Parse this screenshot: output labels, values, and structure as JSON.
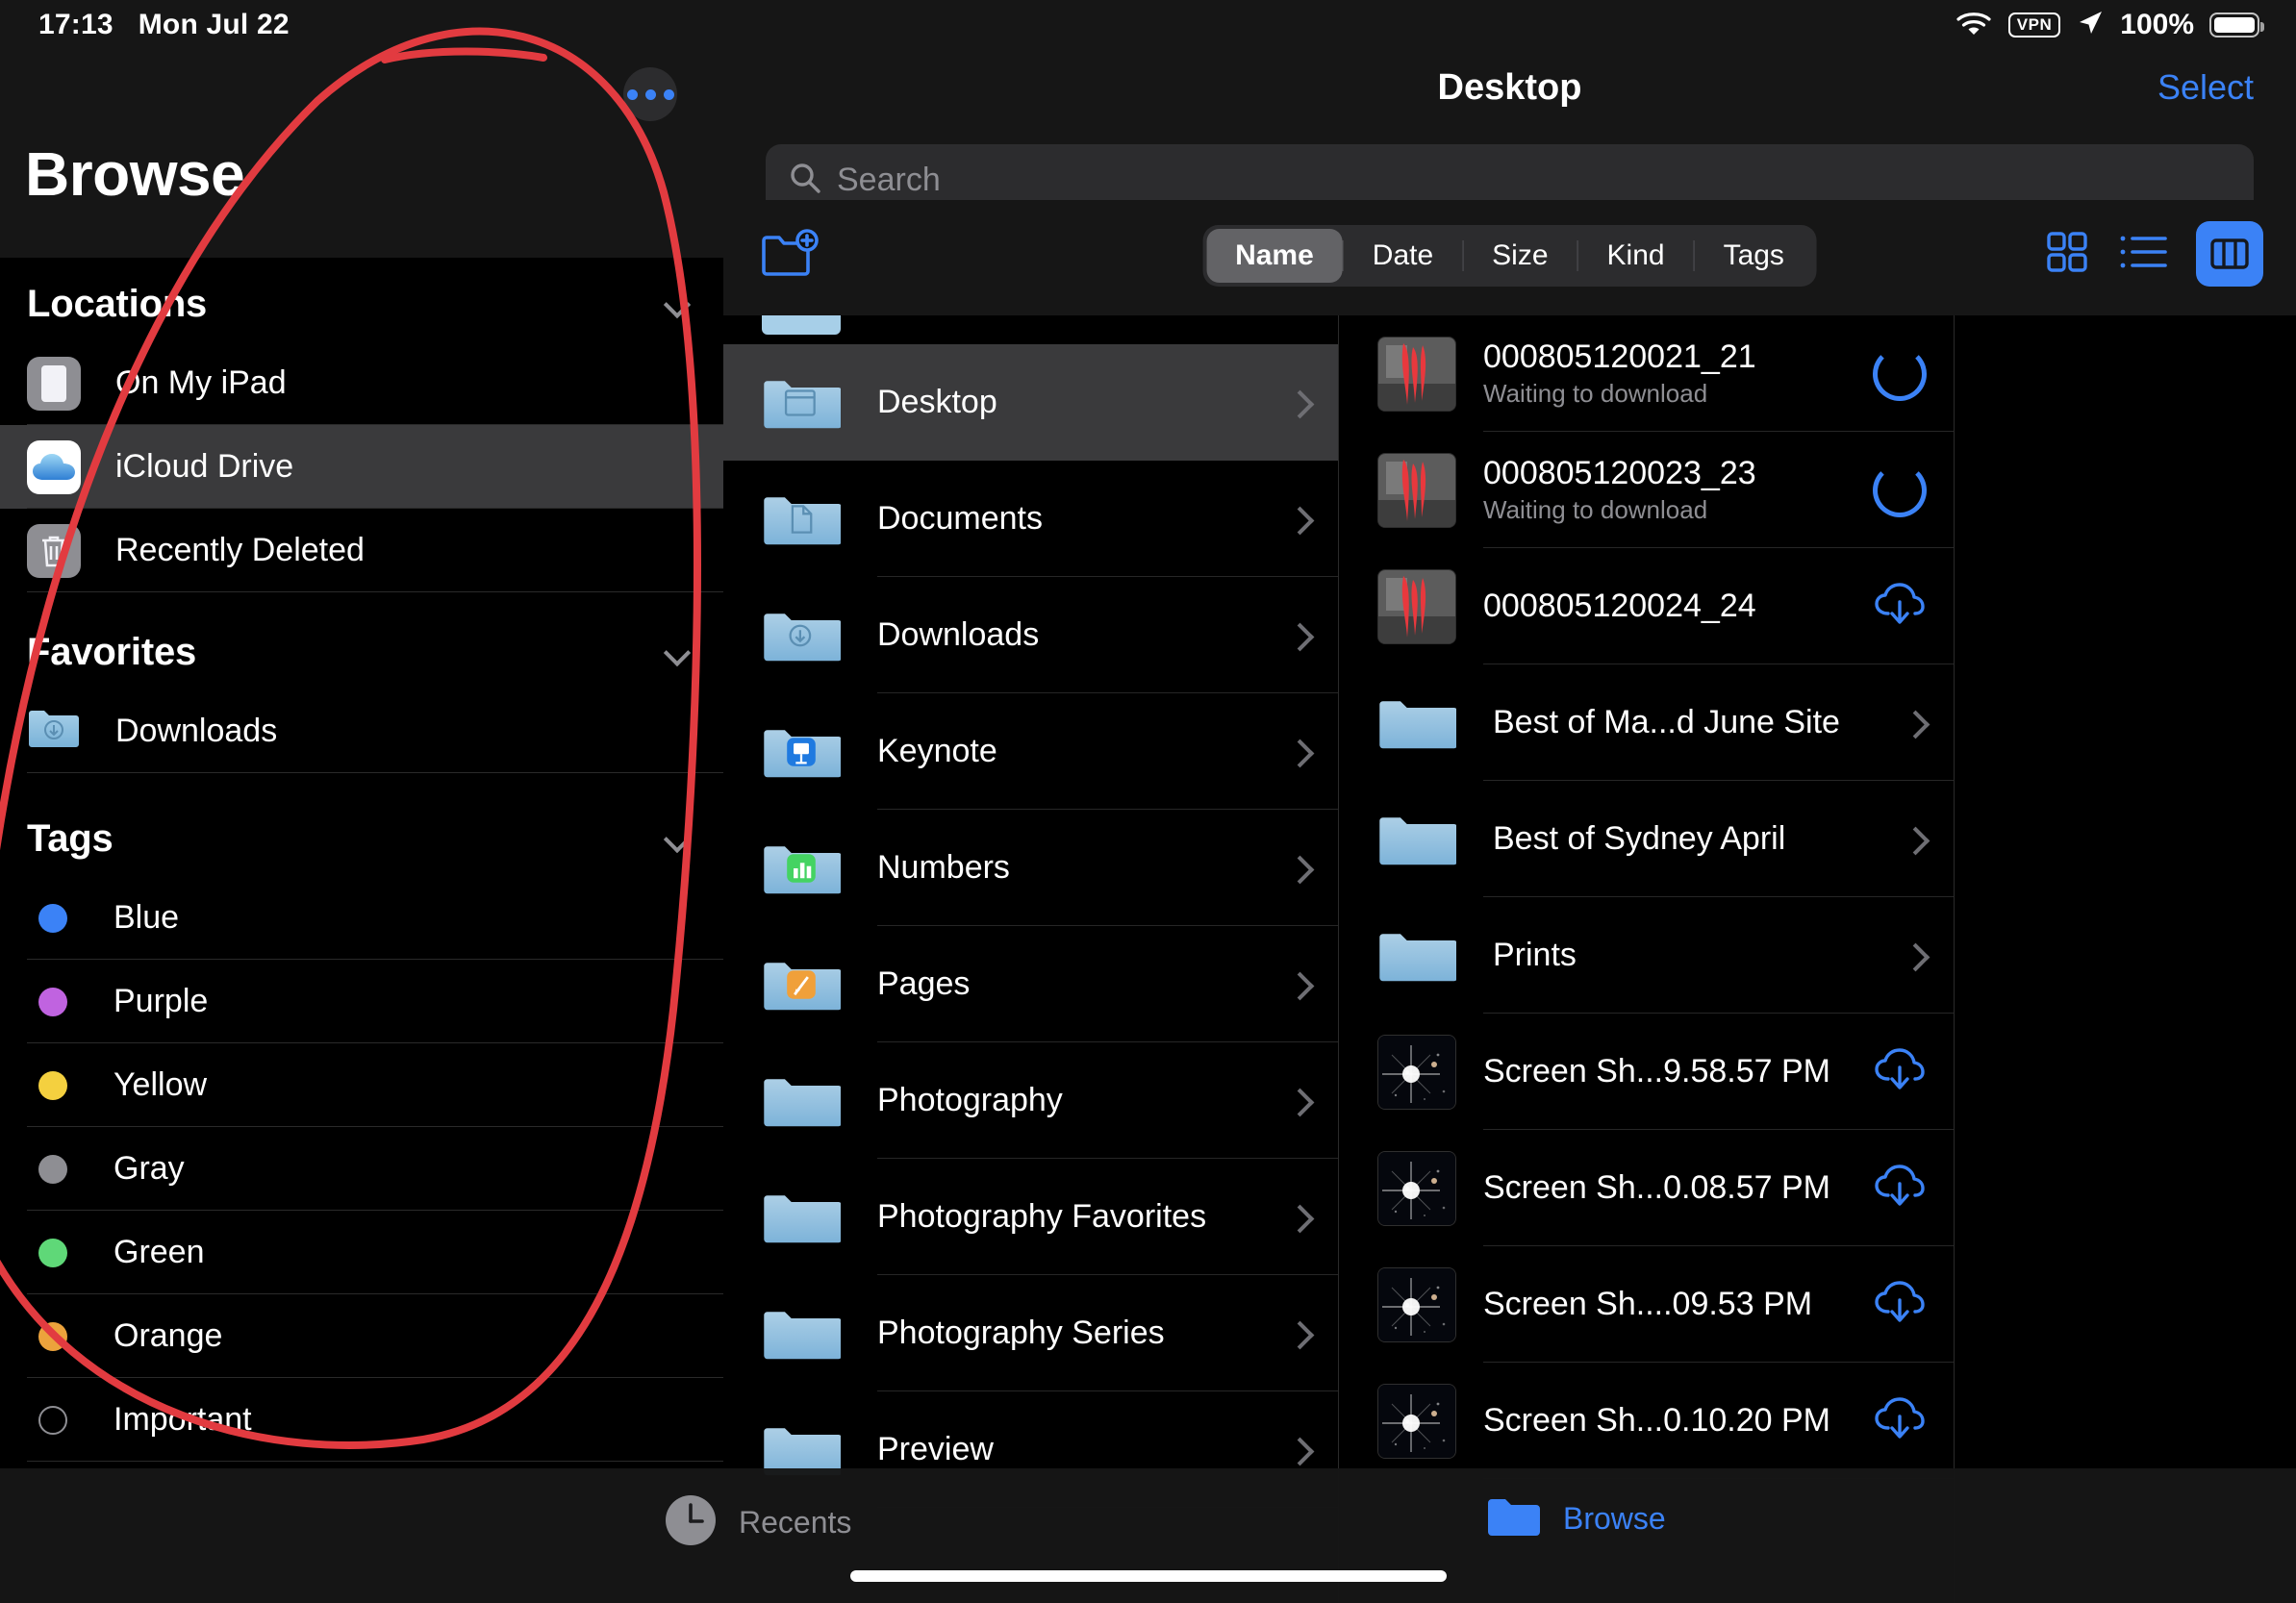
{
  "status_bar": {
    "time": "17:13",
    "date": "Mon Jul 22",
    "wifi_icon": "wifi-icon",
    "vpn_label": "VPN",
    "location_icon": "location-arrow-icon",
    "battery_percent": "100%",
    "battery_icon": "battery-full-icon"
  },
  "sidebar": {
    "title": "Browse",
    "more_button_icon": "ellipsis-icon",
    "sections": [
      {
        "header": "Locations",
        "collapse_icon": "chevron-down-icon",
        "items": [
          {
            "label": "On My iPad",
            "icon": "ipad-icon",
            "selected": false
          },
          {
            "label": "iCloud Drive",
            "icon": "icloud-drive-icon",
            "selected": true
          },
          {
            "label": "Recently Deleted",
            "icon": "trash-icon",
            "selected": false
          }
        ]
      },
      {
        "header": "Favorites",
        "collapse_icon": "chevron-down-icon",
        "items": [
          {
            "label": "Downloads",
            "icon": "downloads-folder-icon",
            "selected": false
          }
        ]
      },
      {
        "header": "Tags",
        "collapse_icon": "chevron-down-icon",
        "tags": [
          {
            "label": "Blue",
            "color": "#3b82f6",
            "hollow": false
          },
          {
            "label": "Purple",
            "color": "#c063e0",
            "hollow": false
          },
          {
            "label": "Yellow",
            "color": "#f4d03f",
            "hollow": false
          },
          {
            "label": "Gray",
            "color": "#8e8e93",
            "hollow": false
          },
          {
            "label": "Green",
            "color": "#5fd878",
            "hollow": false
          },
          {
            "label": "Orange",
            "color": "#eca33c",
            "hollow": false
          },
          {
            "label": "Important",
            "color": "#8e8e93",
            "hollow": true
          }
        ]
      }
    ]
  },
  "nav": {
    "title": "Desktop",
    "select_label": "Select"
  },
  "search": {
    "placeholder": "Search",
    "icon": "search-icon",
    "value": ""
  },
  "toolbar": {
    "new_folder_icon": "new-folder-icon",
    "sort_options": [
      "Name",
      "Date",
      "Size",
      "Kind",
      "Tags"
    ],
    "sort_selected": "Name",
    "view_modes": [
      {
        "name": "grid-view-icon",
        "selected": false
      },
      {
        "name": "list-view-icon",
        "selected": false
      },
      {
        "name": "column-view-icon",
        "selected": true
      }
    ]
  },
  "column_folders": [
    {
      "label": "Desktop",
      "icon": "desktop-folder-icon",
      "selected": true
    },
    {
      "label": "Documents",
      "icon": "documents-folder-icon",
      "selected": false
    },
    {
      "label": "Downloads",
      "icon": "downloads-folder-icon",
      "selected": false
    },
    {
      "label": "Keynote",
      "icon": "keynote-folder-icon",
      "selected": false
    },
    {
      "label": "Numbers",
      "icon": "numbers-folder-icon",
      "selected": false
    },
    {
      "label": "Pages",
      "icon": "pages-folder-icon",
      "selected": false
    },
    {
      "label": "Photography",
      "icon": "folder-icon",
      "selected": false
    },
    {
      "label": "Photography Favorites",
      "icon": "folder-icon",
      "selected": false
    },
    {
      "label": "Photography Series",
      "icon": "folder-icon",
      "selected": false
    },
    {
      "label": "Preview",
      "icon": "folder-icon",
      "selected": false
    }
  ],
  "file_list": [
    {
      "name": "000805120021_21",
      "subtitle": "Waiting to download",
      "kind": "image",
      "thumb": "redacted-photo",
      "accessory": "progress-ring"
    },
    {
      "name": "000805120023_23",
      "subtitle": "Waiting to download",
      "kind": "image",
      "thumb": "redacted-photo",
      "accessory": "progress-ring"
    },
    {
      "name": "000805120024_24",
      "subtitle": "",
      "kind": "image",
      "thumb": "redacted-photo",
      "accessory": "download-cloud-icon"
    },
    {
      "name": "Best of Ma...d June Site",
      "subtitle": "",
      "kind": "folder",
      "thumb": "folder-icon",
      "accessory": "chevron-right-icon"
    },
    {
      "name": "Best of Sydney April",
      "subtitle": "",
      "kind": "folder",
      "thumb": "folder-icon",
      "accessory": "chevron-right-icon"
    },
    {
      "name": "Prints",
      "subtitle": "",
      "kind": "folder",
      "thumb": "folder-icon",
      "accessory": "chevron-right-icon"
    },
    {
      "name": "Screen Sh...9.58.57 PM",
      "subtitle": "",
      "kind": "image",
      "thumb": "starfield",
      "accessory": "download-cloud-icon"
    },
    {
      "name": "Screen Sh...0.08.57 PM",
      "subtitle": "",
      "kind": "image",
      "thumb": "starfield",
      "accessory": "download-cloud-icon"
    },
    {
      "name": "Screen Sh....09.53 PM",
      "subtitle": "",
      "kind": "image",
      "thumb": "starfield",
      "accessory": "download-cloud-icon"
    },
    {
      "name": "Screen Sh...0.10.20 PM",
      "subtitle": "",
      "kind": "image",
      "thumb": "starfield",
      "accessory": "download-cloud-icon"
    }
  ],
  "tab_bar": [
    {
      "label": "Recents",
      "icon": "clock-icon",
      "active": false
    },
    {
      "label": "Browse",
      "icon": "folder-icon",
      "active": true
    }
  ],
  "annotation": {
    "type": "hand-drawn-ellipse",
    "color": "#e23b40"
  },
  "colors": {
    "accent": "#3b82f6",
    "background": "#000000",
    "panel": "#161616",
    "selected_row": "#3a3a3c",
    "secondary_text": "#8e8e93",
    "annotation_red": "#e23b40"
  }
}
